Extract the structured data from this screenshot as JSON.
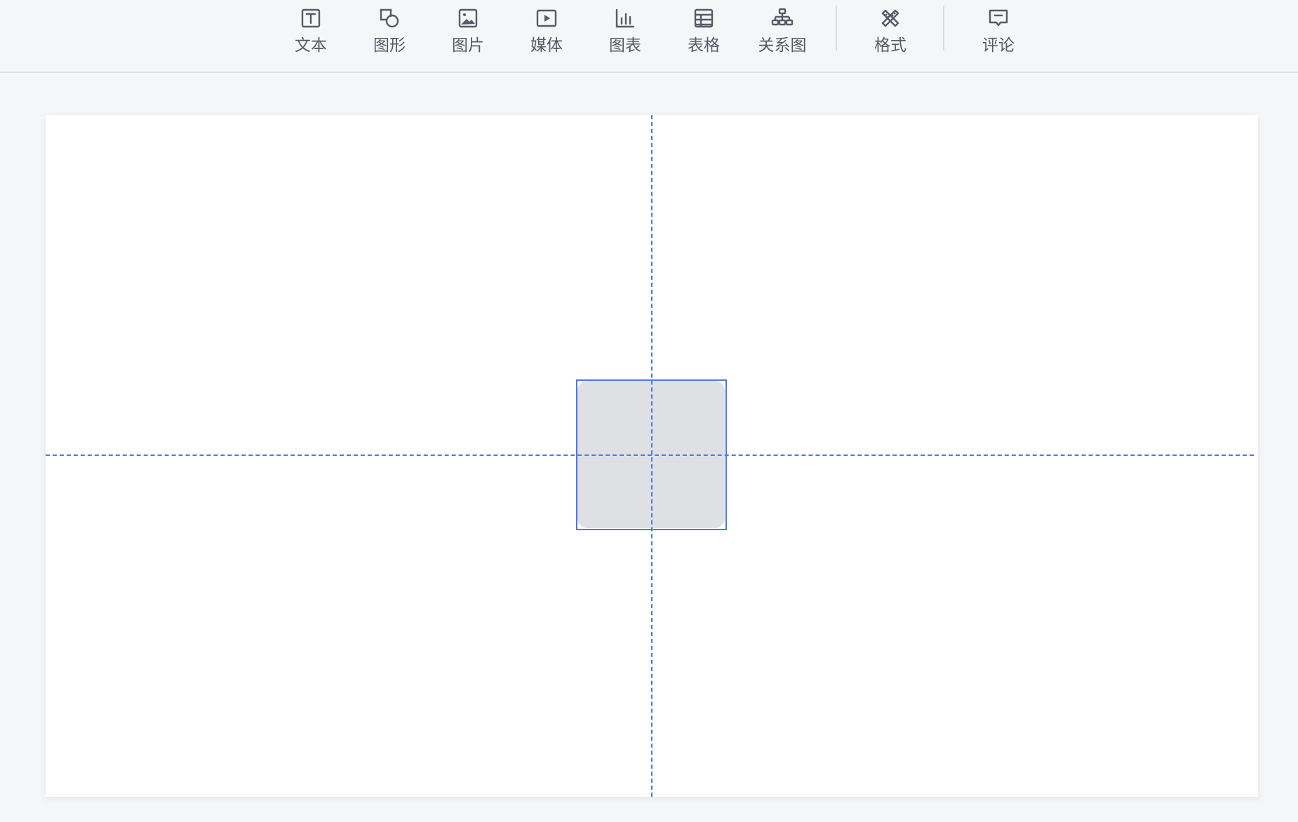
{
  "toolbar": {
    "items": [
      {
        "label": "文本",
        "icon": "text-icon"
      },
      {
        "label": "图形",
        "icon": "shape-icon"
      },
      {
        "label": "图片",
        "icon": "image-icon"
      },
      {
        "label": "媒体",
        "icon": "media-icon"
      },
      {
        "label": "图表",
        "icon": "chart-icon"
      },
      {
        "label": "表格",
        "icon": "table-icon"
      },
      {
        "label": "关系图",
        "icon": "diagram-icon"
      },
      {
        "label": "格式",
        "icon": "format-icon"
      },
      {
        "label": "评论",
        "icon": "comment-icon"
      }
    ]
  },
  "colors": {
    "accent": "#4a78e6",
    "shape_fill": "#dfe0e4",
    "icon": "#555b66",
    "background": "#f5f6f8"
  }
}
